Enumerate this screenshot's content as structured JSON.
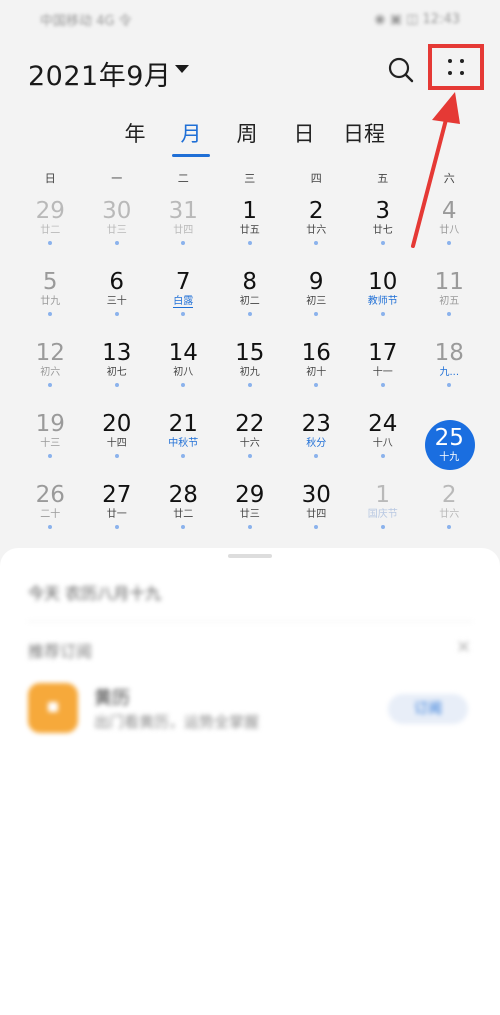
{
  "status_bar": {
    "left_text": "中国移动 4G 令",
    "right_text": "◉ ▣ ◫ 12:43"
  },
  "header": {
    "month_title": "2021年9月",
    "search_icon": "search-icon",
    "more_icon": "more-dots-icon"
  },
  "view_tabs": [
    {
      "label": "年"
    },
    {
      "label": "月",
      "active": true
    },
    {
      "label": "周"
    },
    {
      "label": "日"
    },
    {
      "label": "日程"
    }
  ],
  "weekdays": [
    "日",
    "一",
    "二",
    "三",
    "四",
    "五",
    "六"
  ],
  "calendar": {
    "weeks": [
      [
        {
          "day": "29",
          "lunar": "廿二",
          "muted": true,
          "dot": true
        },
        {
          "day": "30",
          "lunar": "廿三",
          "muted": true,
          "dot": true
        },
        {
          "day": "31",
          "lunar": "廿四",
          "muted": true,
          "dot": true
        },
        {
          "day": "1",
          "lunar": "廿五",
          "dot": true
        },
        {
          "day": "2",
          "lunar": "廿六",
          "dot": true
        },
        {
          "day": "3",
          "lunar": "廿七",
          "dot": true
        },
        {
          "day": "4",
          "lunar": "廿八",
          "weekend": true,
          "dot": true
        }
      ],
      [
        {
          "day": "5",
          "lunar": "廿九",
          "weekend": true,
          "dot": true
        },
        {
          "day": "6",
          "lunar": "三十",
          "dot": true
        },
        {
          "day": "7",
          "lunar": "白露",
          "festival": true,
          "underlined": true,
          "dot": true
        },
        {
          "day": "8",
          "lunar": "初二",
          "dot": true
        },
        {
          "day": "9",
          "lunar": "初三",
          "dot": true
        },
        {
          "day": "10",
          "lunar": "教师节",
          "festival": true,
          "dot": true
        },
        {
          "day": "11",
          "lunar": "初五",
          "weekend": true,
          "dot": true
        }
      ],
      [
        {
          "day": "12",
          "lunar": "初六",
          "weekend": true,
          "dot": true
        },
        {
          "day": "13",
          "lunar": "初七",
          "dot": true
        },
        {
          "day": "14",
          "lunar": "初八",
          "dot": true
        },
        {
          "day": "15",
          "lunar": "初九",
          "dot": true
        },
        {
          "day": "16",
          "lunar": "初十",
          "dot": true
        },
        {
          "day": "17",
          "lunar": "十一",
          "dot": true
        },
        {
          "day": "18",
          "lunar": "九...",
          "weekend": true,
          "festival": true,
          "dot": true
        }
      ],
      [
        {
          "day": "19",
          "lunar": "十三",
          "weekend": true,
          "dot": true
        },
        {
          "day": "20",
          "lunar": "十四",
          "dot": true
        },
        {
          "day": "21",
          "lunar": "中秋节",
          "festival": true,
          "dot": true
        },
        {
          "day": "22",
          "lunar": "十六",
          "dot": true
        },
        {
          "day": "23",
          "lunar": "秋分",
          "festival": true,
          "dot": true
        },
        {
          "day": "24",
          "lunar": "十八",
          "dot": true
        },
        {
          "day": "25",
          "lunar": "十九",
          "today": true
        }
      ],
      [
        {
          "day": "26",
          "lunar": "二十",
          "weekend": true,
          "dot": true
        },
        {
          "day": "27",
          "lunar": "廿一",
          "dot": true
        },
        {
          "day": "28",
          "lunar": "廿二",
          "dot": true
        },
        {
          "day": "29",
          "lunar": "廿三",
          "dot": true
        },
        {
          "day": "30",
          "lunar": "廿四",
          "dot": true
        },
        {
          "day": "1",
          "lunar": "国庆节",
          "muted": true,
          "festival": true,
          "dot": true
        },
        {
          "day": "2",
          "lunar": "廿六",
          "muted": true,
          "dot": true
        }
      ]
    ]
  },
  "sheet": {
    "today_line": "今天 农历八月十九",
    "recommend_title": "推荐订阅",
    "close_icon": "close-icon",
    "app_name": "黄历",
    "app_desc": "出门看黄历，运势全掌握",
    "subscribe_label": "订阅"
  },
  "colors": {
    "accent": "#1f6fd6",
    "highlight_border": "#e53935",
    "app_icon": "#f6a93b"
  }
}
